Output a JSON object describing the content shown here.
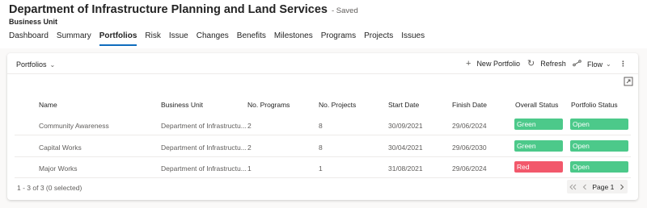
{
  "header": {
    "title": "Department of Infrastructure Planning and Land Services",
    "saved_status": "- Saved",
    "entity_label": "Business Unit"
  },
  "tabs": [
    "Dashboard",
    "Summary",
    "Portfolios",
    "Risk",
    "Issue",
    "Changes",
    "Benefits",
    "Milestones",
    "Programs",
    "Projects",
    "Issues"
  ],
  "active_tab": "Portfolios",
  "subgrid": {
    "view_name": "Portfolios",
    "commands": {
      "new_portfolio": "New Portfolio",
      "refresh": "Refresh",
      "flow": "Flow",
      "more": "⋮"
    },
    "columns": [
      "Name",
      "Business Unit",
      "No. Programs",
      "No. Projects",
      "Start Date",
      "Finish Date",
      "Overall Status",
      "Portfolio Status"
    ],
    "rows": [
      {
        "name": "Community Awareness",
        "business_unit": "Department of Infrastructu...",
        "programs": "2",
        "projects": "8",
        "start": "30/09/2021",
        "finish": "29/06/2024",
        "overall": "Green",
        "status": "Open"
      },
      {
        "name": "Capital Works",
        "business_unit": "Department of Infrastructu...",
        "programs": "2",
        "projects": "8",
        "start": "30/04/2021",
        "finish": "29/06/2030",
        "overall": "Green",
        "status": "Open"
      },
      {
        "name": "Major Works",
        "business_unit": "Department of Infrastructu...",
        "programs": "1",
        "projects": "1",
        "start": "31/08/2021",
        "finish": "29/06/2024",
        "overall": "Red",
        "status": "Open"
      }
    ],
    "footer": "1 - 3 of 3 (0 selected)",
    "pager_label": "Page 1"
  },
  "colors": {
    "green": "#4cc98a",
    "red": "#f2586b",
    "accent": "#0f6cbd"
  },
  "icons": {
    "view_chevron": "chevron-down-icon",
    "new": "plus-icon",
    "refresh": "refresh-icon",
    "flow": "flow-icon",
    "expand": "expand-icon",
    "first_page": "first-page-icon",
    "prev_page": "previous-page-icon",
    "next_page": "next-page-icon"
  }
}
